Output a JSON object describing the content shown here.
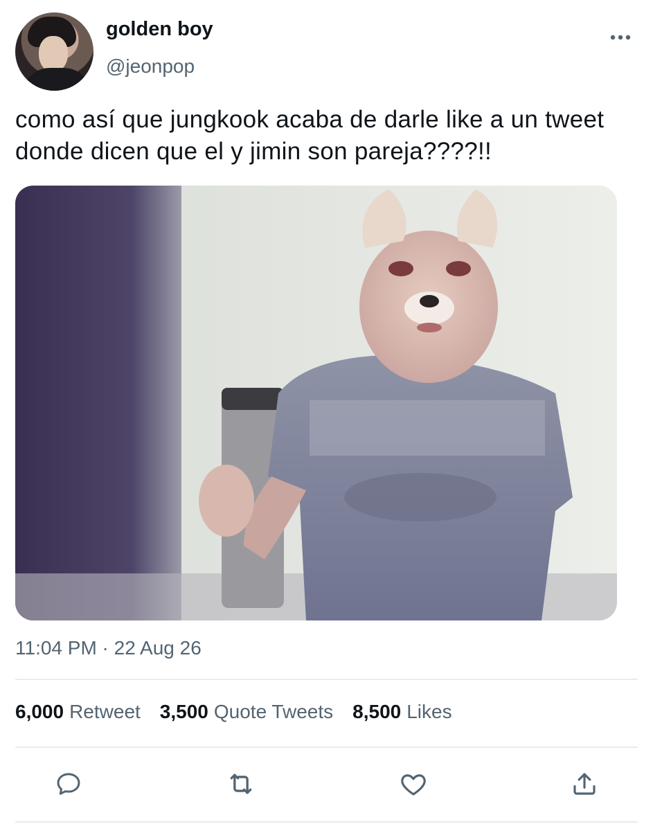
{
  "author": {
    "display_name": "golden boy",
    "handle": "@jeonpop"
  },
  "tweet": {
    "text": "como así que jungkook acaba de darle like a un tweet donde dicen que el y jimin son pareja????!!",
    "timestamp": "11:04 PM · 22 Aug 26"
  },
  "stats": {
    "retweets_count": "6,000",
    "retweets_label": "Retweet",
    "quotes_count": "3,500",
    "quotes_label": "Quote Tweets",
    "likes_count": "8,500",
    "likes_label": "Likes"
  },
  "icons": {
    "more": "more-dots-icon",
    "reply": "reply-icon",
    "retweet": "retweet-icon",
    "like": "heart-icon",
    "share": "share-icon"
  },
  "colors": {
    "text_primary": "#0f1419",
    "text_secondary": "#536471",
    "divider": "#e6ecf0"
  }
}
